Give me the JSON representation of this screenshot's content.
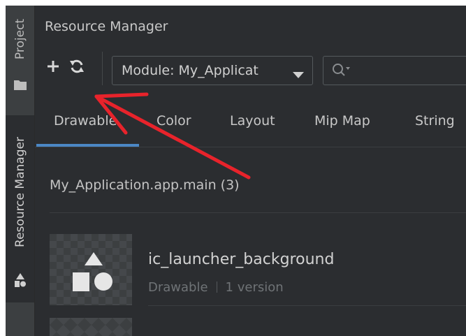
{
  "sidebar": {
    "tabs": [
      {
        "label": "Project",
        "icon": "folder-icon"
      },
      {
        "label": "Resource Manager",
        "icon": "resource-manager-icon"
      }
    ]
  },
  "panel": {
    "title": "Resource Manager"
  },
  "toolbar": {
    "add_icon": "plus-icon",
    "refresh_icon": "refresh-icon",
    "module_select_value": "Module: My_Applicat",
    "search_icon": "search-icon"
  },
  "tabs": [
    {
      "label": "Drawable",
      "active": true
    },
    {
      "label": "Color",
      "active": false
    },
    {
      "label": "Layout",
      "active": false
    },
    {
      "label": "Mip Map",
      "active": false
    },
    {
      "label": "String",
      "active": false
    }
  ],
  "resources": {
    "group_title": "My_Application.app.main (3)",
    "items": [
      {
        "name": "ic_launcher_background",
        "type": "Drawable",
        "versions": "1 version"
      }
    ]
  },
  "colors": {
    "background": "#2b2d30",
    "accent": "#4b87c5",
    "annotation_arrow": "#e8232b"
  }
}
